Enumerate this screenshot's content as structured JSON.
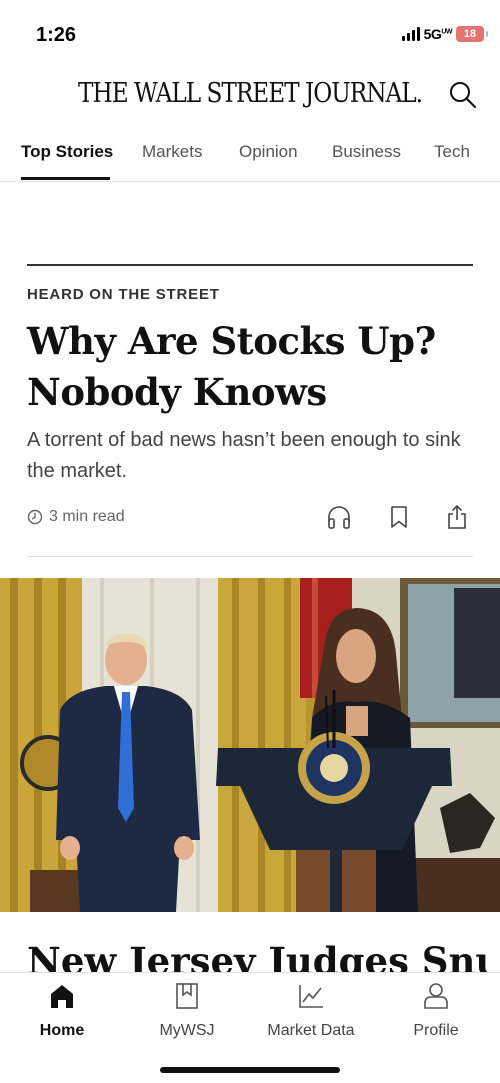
{
  "status_bar": {
    "time": "1:26",
    "network": "5G",
    "network_superscript": "UW",
    "battery": "18",
    "battery_color": "#e57373"
  },
  "masthead": {
    "logo": "THE WALL STREET JOURNAL.",
    "search_icon": "search-icon"
  },
  "tabs": [
    {
      "label": "Top Stories",
      "active": true
    },
    {
      "label": "Markets",
      "active": false
    },
    {
      "label": "Opinion",
      "active": false
    },
    {
      "label": "Business",
      "active": false
    },
    {
      "label": "Tech",
      "active": false
    }
  ],
  "article": {
    "kicker": "HEARD ON THE STREET",
    "headline": "Why Are Stocks Up? Nobody Knows",
    "summary": "A torrent of bad news hasn’t been enough to sink the market.",
    "read_time": "3 min read",
    "actions": [
      "headphones-icon",
      "bookmark-icon",
      "share-icon"
    ]
  },
  "next_article": {
    "headline": "New Jersey Judges Snub"
  },
  "bottom_nav": [
    {
      "label": "Home",
      "icon": "home-icon",
      "active": true
    },
    {
      "label": "MyWSJ",
      "icon": "mywsj-icon",
      "active": false
    },
    {
      "label": "Market Data",
      "icon": "chart-icon",
      "active": false
    },
    {
      "label": "Profile",
      "icon": "profile-icon",
      "active": false
    }
  ]
}
